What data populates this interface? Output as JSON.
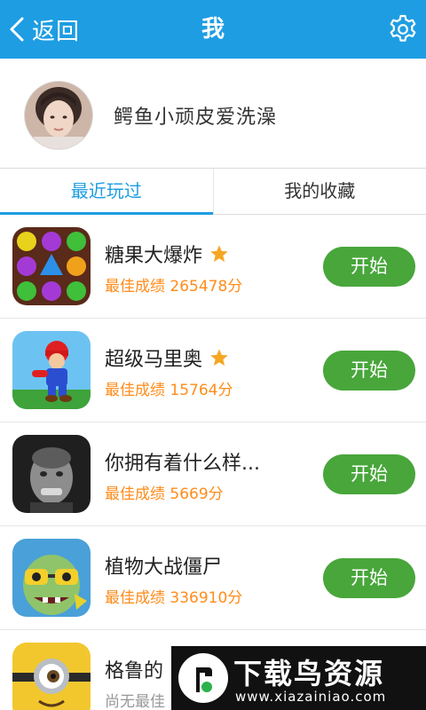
{
  "header": {
    "back_label": "返回",
    "title": "我",
    "bg_color": "#1e9de2"
  },
  "profile": {
    "username": "鳄鱼小顽皮爱洗澡"
  },
  "tabs": [
    {
      "label": "最近玩过",
      "active": true
    },
    {
      "label": "我的收藏",
      "active": false
    }
  ],
  "games": [
    {
      "name": "糖果大爆炸",
      "starred": true,
      "score": "最佳成绩 265478分",
      "button": "开始"
    },
    {
      "name": "超级马里奥",
      "starred": true,
      "score": "最佳成绩 15764分",
      "button": "开始"
    },
    {
      "name": "你拥有着什么样...",
      "starred": false,
      "score": "最佳成绩 5669分",
      "button": "开始"
    },
    {
      "name": "植物大战僵尸",
      "starred": false,
      "score": "最佳成绩 336910分",
      "button": "开始"
    },
    {
      "name": "格鲁的",
      "starred": false,
      "score": "尚无最佳",
      "button": ""
    }
  ],
  "watermark": {
    "title": "下载鸟资源",
    "url": "www.xiazainiao.com"
  },
  "colors": {
    "accent": "#1e9de2",
    "start_button": "#48a63b",
    "score": "#ff8c1a",
    "star": "#f5a623"
  }
}
